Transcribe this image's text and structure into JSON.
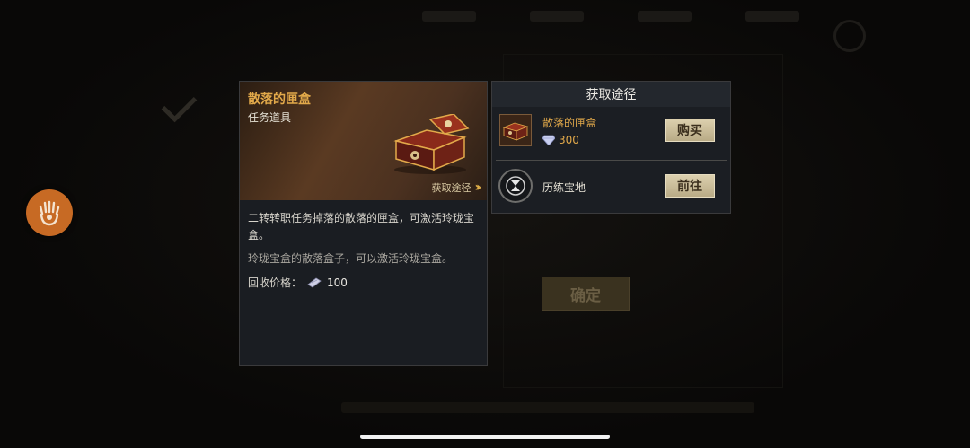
{
  "item": {
    "name": "散落的匣盒",
    "type": "任务道具",
    "obtain_link": "获取途径",
    "description": "二转转职任务掉落的散落的匣盒，可激活玲珑宝盒。",
    "description2": "玲珑宝盒的散落盒子，可以激活玲珑宝盒。",
    "recycle_label": "回收价格：",
    "recycle_value": "100"
  },
  "obtain_panel": {
    "title": "获取途径",
    "sources": [
      {
        "name": "散落的匣盒",
        "price": "300",
        "button": "购买"
      },
      {
        "name": "历练宝地",
        "button": "前往"
      }
    ]
  },
  "background": {
    "confirm_button": "确定"
  },
  "colors": {
    "gold_text": "#e2a94a",
    "button_bg": "#cfc29c",
    "hand_button": "#c76a24"
  }
}
